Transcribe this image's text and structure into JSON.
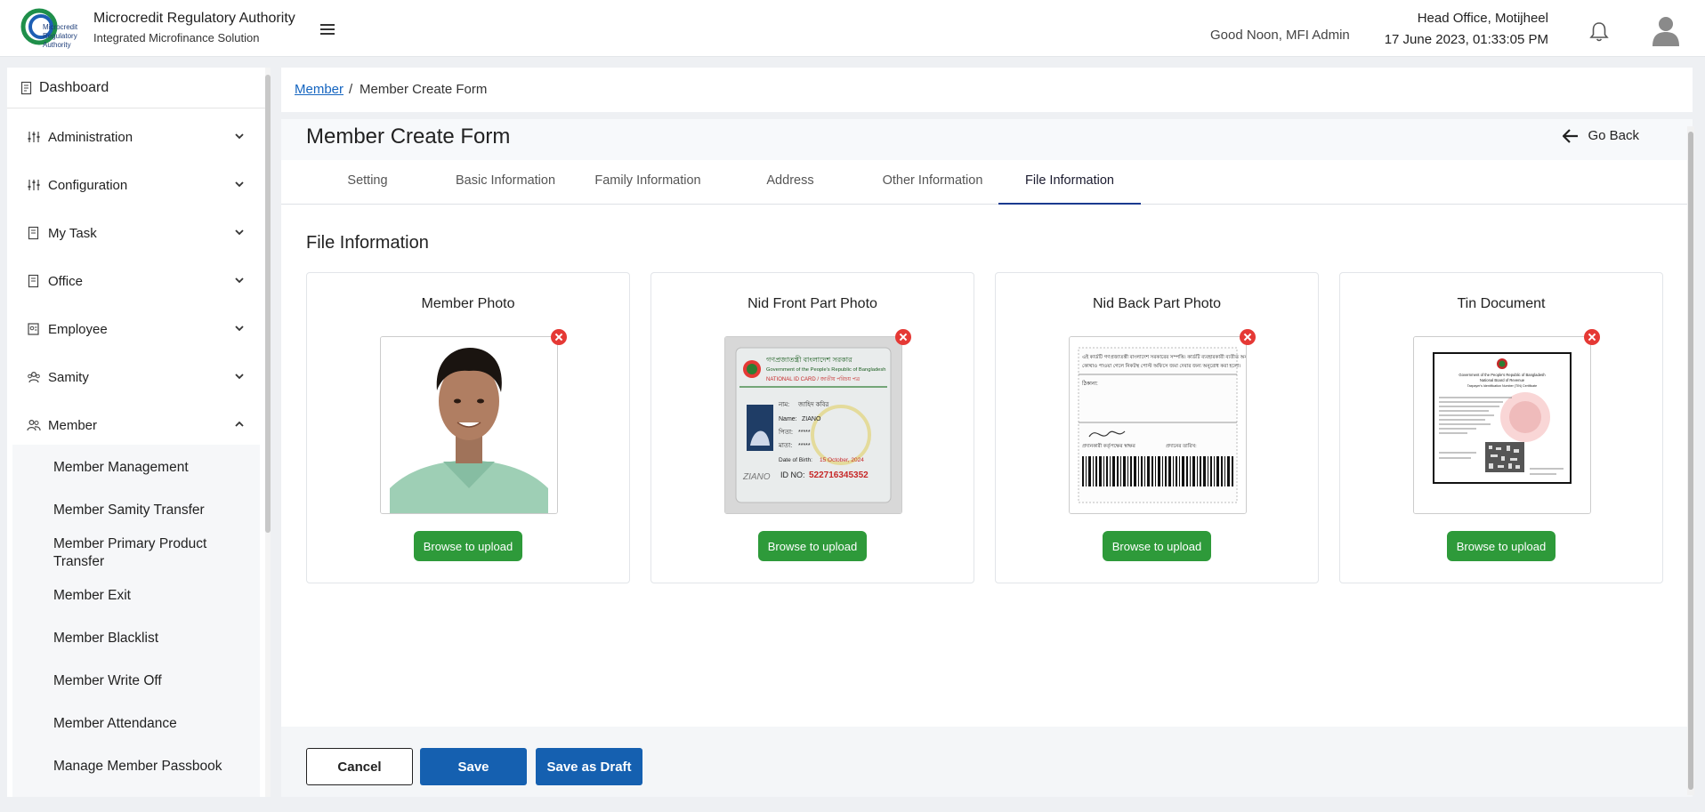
{
  "header": {
    "brand_name": "Microcredit Regulatory Authority",
    "brand_subtitle": "Integrated Microfinance Solution",
    "greeting": "Good Noon, MFI Admin",
    "office_name": "Head Office, Motijheel",
    "datetime": "17 June 2023, 01:33:05 PM",
    "logo_text_1": "Microcredit",
    "logo_text_2": "Regulatory",
    "logo_text_3": "Authority"
  },
  "sidebar": {
    "dashboard": "Dashboard",
    "items": [
      {
        "label": "Administration",
        "icon": "sliders-icon",
        "expanded": false
      },
      {
        "label": "Configuration",
        "icon": "sliders-icon",
        "expanded": false
      },
      {
        "label": "My Task",
        "icon": "document-icon",
        "expanded": false
      },
      {
        "label": "Office",
        "icon": "document-icon",
        "expanded": false
      },
      {
        "label": "Employee",
        "icon": "id-card-icon",
        "expanded": false
      },
      {
        "label": "Samity",
        "icon": "group-icon",
        "expanded": false
      },
      {
        "label": "Member",
        "icon": "users-icon",
        "expanded": true
      }
    ],
    "member_submenu": [
      "Member Management",
      "Member Samity Transfer",
      "Member Primary Product Transfer",
      "Member Exit",
      "Member Blacklist",
      "Member Write Off",
      "Member Attendance",
      "Manage Member Passbook"
    ]
  },
  "breadcrumb": {
    "parent": "Member",
    "separator": "/",
    "current": "Member Create Form"
  },
  "form": {
    "title": "Member Create Form",
    "go_back": "Go Back",
    "tabs": [
      {
        "label": "Setting",
        "active": false
      },
      {
        "label": "Basic Information",
        "active": false
      },
      {
        "label": "Family Information",
        "active": false
      },
      {
        "label": "Address",
        "active": false
      },
      {
        "label": "Other Information",
        "active": false
      },
      {
        "label": "File Information",
        "active": true
      }
    ],
    "section_title": "File Information",
    "files": [
      {
        "title": "Member Photo",
        "upload_label": "Browse to upload"
      },
      {
        "title": "Nid Front Part Photo",
        "upload_label": "Browse to upload"
      },
      {
        "title": "Nid Back Part Photo",
        "upload_label": "Browse to upload"
      },
      {
        "title": "Tin Document",
        "upload_label": "Browse to upload"
      }
    ],
    "nid_front": {
      "bn_header": "গণপ্রজাতন্ত্রী বাংলাদেশ সরকার",
      "en_header": "Government of the People's Republic of Bangladesh",
      "card_type": "NATIONAL ID CARD / জাতীয় পরিচয় পত্র",
      "name_bn_label": "নাম:",
      "name_bn": "জাহিদ কবির",
      "name_label": "Name:",
      "name": "ZIANO",
      "father_label": "পিতা:",
      "father": "*****",
      "mother_label": "মাতা:",
      "mother": "*****",
      "dob_label": "Date of Birth:",
      "dob": "15 October, 2024",
      "id_label": "ID NO:",
      "id_no": "522716345352",
      "signature": "ZIANO"
    },
    "nid_back": {
      "line1": "এই কার্ডটি গণপ্রজাতন্ত্রী বাংলাদেশ সরকারের সম্পত্তি। কার্ডটি ব্যবহারকারী ব্যতীত অন্য",
      "line2": "কোথাও পাওয়া গেলে নিকটস্থ পোস্ট অফিসে জমা দেবার জন্য অনুরোধ করা হলো।",
      "address_label": "ঠিকানা:",
      "issuer": "প্রদানকারী কর্তৃপক্ষের স্বাক্ষর",
      "issue_date": "প্রদানের তারিখ:"
    },
    "tin_doc": {
      "gov": "Government of the People's Republic of Bangladesh",
      "board": "National Board of Revenue",
      "title": "Taxpayer's Identification Number (TIN) Certificate"
    },
    "buttons": {
      "cancel": "Cancel",
      "save": "Save",
      "draft": "Save as Draft"
    }
  },
  "colors": {
    "accent_blue": "#1560b0",
    "upload_green": "#2e9a3a",
    "remove_red": "#e53935",
    "link_blue": "#1565c0"
  }
}
